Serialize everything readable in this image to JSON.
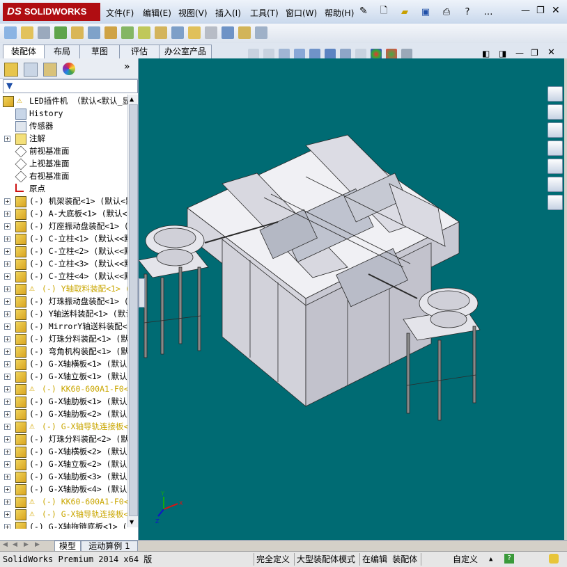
{
  "app": {
    "logo_text": "SOLIDWORKS",
    "logo_prefix": "DS"
  },
  "menu": [
    "文件(F)",
    "编辑(E)",
    "视图(V)",
    "插入(I)",
    "工具(T)",
    "窗口(W)",
    "帮助(H)"
  ],
  "command_tabs": [
    "装配体",
    "布局",
    "草图",
    "评估",
    "办公室产品"
  ],
  "active_tab": "装配体",
  "tree": {
    "root": "LED插件机 （默认<默认_显",
    "items": [
      {
        "label": "History",
        "kind": "history",
        "expand": false
      },
      {
        "label": "传感器",
        "kind": "sensor",
        "expand": false
      },
      {
        "label": "注解",
        "kind": "annotation",
        "expand": true
      },
      {
        "label": "前视基准面",
        "kind": "plane",
        "expand": false
      },
      {
        "label": "上视基准面",
        "kind": "plane",
        "expand": false
      },
      {
        "label": "右视基准面",
        "kind": "plane",
        "expand": false
      },
      {
        "label": "原点",
        "kind": "origin",
        "expand": false
      },
      {
        "label": "(-) 机架装配<1> (默认<默",
        "kind": "asm",
        "expand": true
      },
      {
        "label": "(-) A-大底板<1> (默认<<",
        "kind": "asm",
        "expand": true
      },
      {
        "label": "(-) 灯座振动盘装配<1> (",
        "kind": "asm",
        "expand": true
      },
      {
        "label": "(-) C-立柱<1> (默认<<默",
        "kind": "asm",
        "expand": true
      },
      {
        "label": "(-) C-立柱<2> (默认<<默",
        "kind": "asm",
        "expand": true
      },
      {
        "label": "(-) C-立柱<3> (默认<<默",
        "kind": "asm",
        "expand": true
      },
      {
        "label": "(-) C-立柱<4> (默认<<默",
        "kind": "asm",
        "expand": true
      },
      {
        "label": "(-) Y轴取料装配<1> (",
        "kind": "asm-warn",
        "expand": true
      },
      {
        "label": "(-) 灯珠振动盘装配<1> (",
        "kind": "asm",
        "expand": true
      },
      {
        "label": "(-) Y轴送料装配<1> (默认",
        "kind": "asm",
        "expand": true
      },
      {
        "label": "(-) MirrorY轴送料装配<1",
        "kind": "asm",
        "expand": true
      },
      {
        "label": "(-) 灯珠分料装配<1> (默",
        "kind": "asm",
        "expand": true
      },
      {
        "label": "(-) 弯角机构装配<1> (默",
        "kind": "asm",
        "expand": true
      },
      {
        "label": "(-) G-X轴横板<1> (默认<",
        "kind": "asm",
        "expand": true
      },
      {
        "label": "(-) G-X轴立板<1> (默认<",
        "kind": "asm",
        "expand": true
      },
      {
        "label": "(-) KK60-600A1-F0<1>",
        "kind": "asm-warn",
        "expand": true
      },
      {
        "label": "(-) G-X轴肋板<1> (默认<",
        "kind": "asm",
        "expand": true
      },
      {
        "label": "(-) G-X轴肋板<2> (默认<",
        "kind": "asm",
        "expand": true
      },
      {
        "label": "(-) G-X轴导轨连接板<",
        "kind": "asm-warn",
        "expand": true
      },
      {
        "label": "(-) 灯珠分料装配<2> (默",
        "kind": "asm",
        "expand": true
      },
      {
        "label": "(-) G-X轴横板<2> (默认<",
        "kind": "asm",
        "expand": true
      },
      {
        "label": "(-) G-X轴立板<2> (默认<",
        "kind": "asm",
        "expand": true
      },
      {
        "label": "(-) G-X轴肋板<3> (默认<",
        "kind": "asm",
        "expand": true
      },
      {
        "label": "(-) G-X轴肋板<4> (默认<",
        "kind": "asm",
        "expand": true
      },
      {
        "label": "(-) KK60-600A1-F0<2>",
        "kind": "asm-warn",
        "expand": true
      },
      {
        "label": "(-) G-X轴导轨连接板<",
        "kind": "asm-warn",
        "expand": true
      },
      {
        "label": "(-) G-X轴拖链底板<1> (",
        "kind": "asm",
        "expand": true
      }
    ]
  },
  "bottom_tabs": [
    "模型",
    "运动算例 1"
  ],
  "status": {
    "product": "SolidWorks Premium 2014 x64 版",
    "definition": "完全定义",
    "mode": "大型装配体模式",
    "editing": "在编辑 装配体",
    "units": "自定义"
  },
  "colors": {
    "viewport_bg": "#006b73",
    "warn": "#c9a600",
    "brand": "#b00d12"
  },
  "triad": {
    "x": "X",
    "y": "Y",
    "z": "Z"
  }
}
